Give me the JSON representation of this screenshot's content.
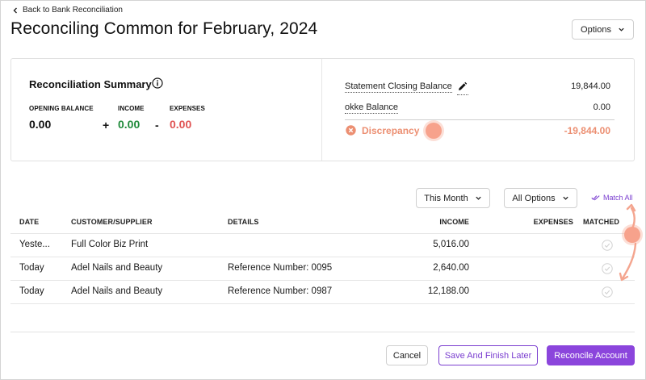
{
  "header": {
    "back_label": "Back to Bank Reconciliation",
    "title": "Reconciling Common for February, 2024",
    "options_label": "Options"
  },
  "summary": {
    "title": "Reconciliation Summary",
    "opening_label": "OPENING BALANCE",
    "opening_value": "0.00",
    "plus_sign": "+",
    "income_label": "INCOME",
    "income_value": "0.00",
    "minus_sign": "-",
    "expenses_label": "EXPENSES",
    "expenses_value": "0.00",
    "statement_label": "Statement Closing Balance",
    "statement_value": "19,844.00",
    "book_label": "okke Balance",
    "book_value": "0.00",
    "discrepancy_label": "Discrepancy",
    "discrepancy_value": "-19,844.00"
  },
  "filters": {
    "period_label": "This Month",
    "options_label": "All Options",
    "match_all_label": "Match All"
  },
  "table": {
    "columns": {
      "date": "DATE",
      "customer": "CUSTOMER/SUPPLIER",
      "details": "DETAILS",
      "income": "INCOME",
      "expenses": "EXPENSES",
      "matched": "MATCHED"
    },
    "rows": [
      {
        "date": "Yeste...",
        "customer": "Full Color Biz Print",
        "details": "",
        "income": "5,016.00",
        "expenses": ""
      },
      {
        "date": "Today",
        "customer": "Adel Nails and Beauty",
        "details": "Reference Number: 0095",
        "income": "2,640.00",
        "expenses": ""
      },
      {
        "date": "Today",
        "customer": "Adel Nails and Beauty",
        "details": "Reference Number: 0987",
        "income": "12,188.00",
        "expenses": ""
      }
    ]
  },
  "footer": {
    "cancel_label": "Cancel",
    "save_later_label": "Save And Finish Later",
    "reconcile_label": "Reconcile Account"
  },
  "colors": {
    "accent": "#8b45dc",
    "income_green": "#1f8a3a",
    "expense_red": "#e05252",
    "discrepancy": "#ec8f72",
    "annotation": "#f7a28c"
  }
}
